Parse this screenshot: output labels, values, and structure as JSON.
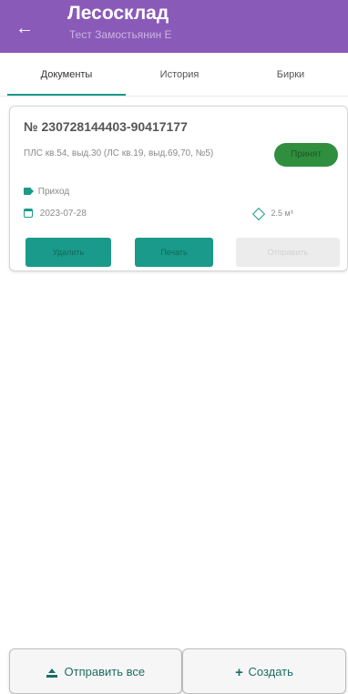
{
  "appbar": {
    "back_icon": "arrow-left-icon",
    "title": "Лесосклад",
    "subtitle": "Тест Замостьянин Е"
  },
  "tabs": [
    {
      "label": "Документы",
      "active": true
    },
    {
      "label": "История",
      "active": false
    },
    {
      "label": "Бирки",
      "active": false
    }
  ],
  "card": {
    "number": "№ 230728144403-90417177",
    "description": "ПЛС кв.54, выд.30 (ЛС кв.19, выд.69,70, №5)",
    "status": "Принят",
    "type_icon": "tag-icon",
    "type": "Приход",
    "date_icon": "calendar-icon",
    "date": "2023-07-28",
    "volume_icon": "cube-icon",
    "volume": "2.5 м³",
    "buttons": {
      "delete": "Удалить",
      "print": "Печать",
      "send": "Отправить"
    }
  },
  "bottom": {
    "send_all": "Отправить все",
    "send_all_icon": "upload-icon",
    "create": "Создать",
    "create_icon": "plus-icon"
  },
  "colors": {
    "appbar": "#8a5ab8",
    "accent": "#1a9a8a",
    "status_badge": "#2f8f3f"
  }
}
